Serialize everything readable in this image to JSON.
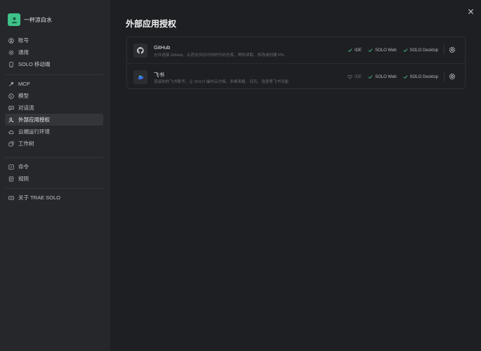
{
  "user": {
    "name": "一杯凉白水",
    "avatar_color": "#3ec28a"
  },
  "sidebar": {
    "group1": [
      {
        "icon": "account-icon",
        "label": "账号"
      },
      {
        "icon": "gear-icon",
        "label": "通用"
      },
      {
        "icon": "mobile-icon",
        "label": "SOLO 移动端"
      }
    ],
    "group2": [
      {
        "icon": "mcp-tool-icon",
        "label": "MCP"
      },
      {
        "icon": "model-icon",
        "label": "模型"
      },
      {
        "icon": "chat-icon",
        "label": "对话流"
      },
      {
        "icon": "external-auth-icon",
        "label": "外部应用授权",
        "active": true
      },
      {
        "icon": "cloud-icon",
        "label": "云端运行环境"
      },
      {
        "icon": "worktree-icon",
        "label": "工作树"
      }
    ],
    "group3": [
      {
        "icon": "command-icon",
        "label": "命令"
      },
      {
        "icon": "rules-icon",
        "label": "规则"
      }
    ],
    "group4": [
      {
        "icon": "about-icon",
        "label": "关于 TRAE SOLO"
      }
    ]
  },
  "page": {
    "title": "外部应用授权"
  },
  "apps": [
    {
      "name": "GitHub",
      "icon": "github-icon",
      "description": "允许连接 GitHub，从而支持访问你的代码仓库，帮你读取、修改或创建 PR。",
      "capabilities": [
        {
          "label": "IDE",
          "enabled": true
        },
        {
          "label": "SOLO Web",
          "enabled": true
        },
        {
          "label": "SOLO Desktop",
          "enabled": true
        }
      ]
    },
    {
      "name": "飞书",
      "icon": "feishu-icon",
      "description": "连接你的飞书账号，让 SOLO 操作云文档、多维表格、日历、消息等飞书功能",
      "capabilities": [
        {
          "label": "IDE",
          "enabled": false
        },
        {
          "label": "SOLO Web",
          "enabled": true
        },
        {
          "label": "SOLO Desktop",
          "enabled": true
        }
      ]
    }
  ],
  "colors": {
    "accent": "#3ec28a",
    "check": "#4fc38f",
    "sidebar_bg": "#26272b",
    "main_bg": "#1e1f22"
  }
}
